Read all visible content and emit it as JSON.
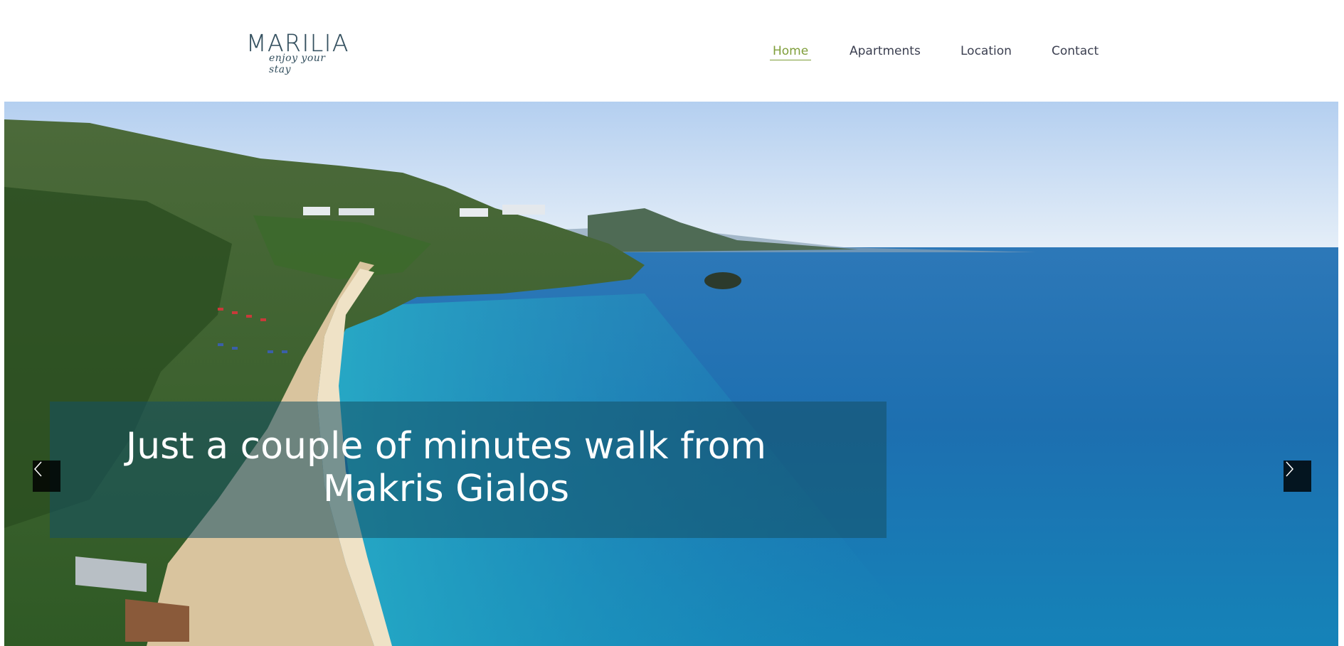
{
  "brand": {
    "name": "MARILIA",
    "tagline": "enjoy your stay"
  },
  "nav": {
    "items": [
      {
        "label": "Home",
        "active": true
      },
      {
        "label": "Apartments",
        "active": false
      },
      {
        "label": "Location",
        "active": false
      },
      {
        "label": "Contact",
        "active": false
      }
    ]
  },
  "hero": {
    "caption": "Just a couple of minutes walk from Makris Gialos",
    "prev_icon": "chevron-left-icon",
    "next_icon": "chevron-right-icon"
  },
  "colors": {
    "nav_active": "#7f9e3a",
    "nav_text": "#3b3f50",
    "caption_overlay": "#145064"
  }
}
